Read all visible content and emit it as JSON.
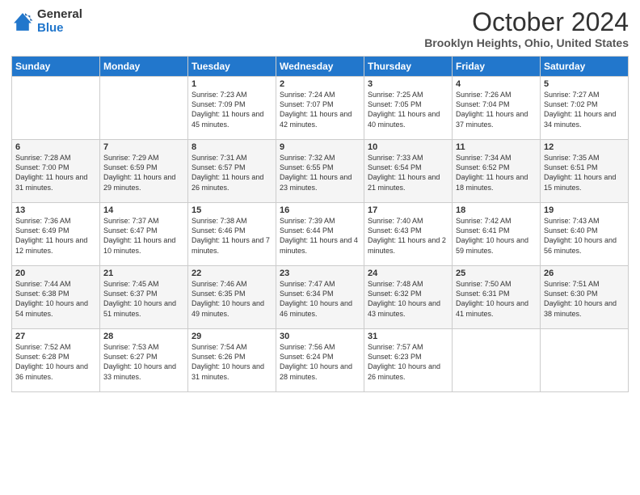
{
  "header": {
    "logo_general": "General",
    "logo_blue": "Blue",
    "title": "October 2024",
    "location": "Brooklyn Heights, Ohio, United States"
  },
  "days_of_week": [
    "Sunday",
    "Monday",
    "Tuesday",
    "Wednesday",
    "Thursday",
    "Friday",
    "Saturday"
  ],
  "weeks": [
    [
      {
        "day": "",
        "info": ""
      },
      {
        "day": "",
        "info": ""
      },
      {
        "day": "1",
        "info": "Sunrise: 7:23 AM\nSunset: 7:09 PM\nDaylight: 11 hours and 45 minutes."
      },
      {
        "day": "2",
        "info": "Sunrise: 7:24 AM\nSunset: 7:07 PM\nDaylight: 11 hours and 42 minutes."
      },
      {
        "day": "3",
        "info": "Sunrise: 7:25 AM\nSunset: 7:05 PM\nDaylight: 11 hours and 40 minutes."
      },
      {
        "day": "4",
        "info": "Sunrise: 7:26 AM\nSunset: 7:04 PM\nDaylight: 11 hours and 37 minutes."
      },
      {
        "day": "5",
        "info": "Sunrise: 7:27 AM\nSunset: 7:02 PM\nDaylight: 11 hours and 34 minutes."
      }
    ],
    [
      {
        "day": "6",
        "info": "Sunrise: 7:28 AM\nSunset: 7:00 PM\nDaylight: 11 hours and 31 minutes."
      },
      {
        "day": "7",
        "info": "Sunrise: 7:29 AM\nSunset: 6:59 PM\nDaylight: 11 hours and 29 minutes."
      },
      {
        "day": "8",
        "info": "Sunrise: 7:31 AM\nSunset: 6:57 PM\nDaylight: 11 hours and 26 minutes."
      },
      {
        "day": "9",
        "info": "Sunrise: 7:32 AM\nSunset: 6:55 PM\nDaylight: 11 hours and 23 minutes."
      },
      {
        "day": "10",
        "info": "Sunrise: 7:33 AM\nSunset: 6:54 PM\nDaylight: 11 hours and 21 minutes."
      },
      {
        "day": "11",
        "info": "Sunrise: 7:34 AM\nSunset: 6:52 PM\nDaylight: 11 hours and 18 minutes."
      },
      {
        "day": "12",
        "info": "Sunrise: 7:35 AM\nSunset: 6:51 PM\nDaylight: 11 hours and 15 minutes."
      }
    ],
    [
      {
        "day": "13",
        "info": "Sunrise: 7:36 AM\nSunset: 6:49 PM\nDaylight: 11 hours and 12 minutes."
      },
      {
        "day": "14",
        "info": "Sunrise: 7:37 AM\nSunset: 6:47 PM\nDaylight: 11 hours and 10 minutes."
      },
      {
        "day": "15",
        "info": "Sunrise: 7:38 AM\nSunset: 6:46 PM\nDaylight: 11 hours and 7 minutes."
      },
      {
        "day": "16",
        "info": "Sunrise: 7:39 AM\nSunset: 6:44 PM\nDaylight: 11 hours and 4 minutes."
      },
      {
        "day": "17",
        "info": "Sunrise: 7:40 AM\nSunset: 6:43 PM\nDaylight: 11 hours and 2 minutes."
      },
      {
        "day": "18",
        "info": "Sunrise: 7:42 AM\nSunset: 6:41 PM\nDaylight: 10 hours and 59 minutes."
      },
      {
        "day": "19",
        "info": "Sunrise: 7:43 AM\nSunset: 6:40 PM\nDaylight: 10 hours and 56 minutes."
      }
    ],
    [
      {
        "day": "20",
        "info": "Sunrise: 7:44 AM\nSunset: 6:38 PM\nDaylight: 10 hours and 54 minutes."
      },
      {
        "day": "21",
        "info": "Sunrise: 7:45 AM\nSunset: 6:37 PM\nDaylight: 10 hours and 51 minutes."
      },
      {
        "day": "22",
        "info": "Sunrise: 7:46 AM\nSunset: 6:35 PM\nDaylight: 10 hours and 49 minutes."
      },
      {
        "day": "23",
        "info": "Sunrise: 7:47 AM\nSunset: 6:34 PM\nDaylight: 10 hours and 46 minutes."
      },
      {
        "day": "24",
        "info": "Sunrise: 7:48 AM\nSunset: 6:32 PM\nDaylight: 10 hours and 43 minutes."
      },
      {
        "day": "25",
        "info": "Sunrise: 7:50 AM\nSunset: 6:31 PM\nDaylight: 10 hours and 41 minutes."
      },
      {
        "day": "26",
        "info": "Sunrise: 7:51 AM\nSunset: 6:30 PM\nDaylight: 10 hours and 38 minutes."
      }
    ],
    [
      {
        "day": "27",
        "info": "Sunrise: 7:52 AM\nSunset: 6:28 PM\nDaylight: 10 hours and 36 minutes."
      },
      {
        "day": "28",
        "info": "Sunrise: 7:53 AM\nSunset: 6:27 PM\nDaylight: 10 hours and 33 minutes."
      },
      {
        "day": "29",
        "info": "Sunrise: 7:54 AM\nSunset: 6:26 PM\nDaylight: 10 hours and 31 minutes."
      },
      {
        "day": "30",
        "info": "Sunrise: 7:56 AM\nSunset: 6:24 PM\nDaylight: 10 hours and 28 minutes."
      },
      {
        "day": "31",
        "info": "Sunrise: 7:57 AM\nSunset: 6:23 PM\nDaylight: 10 hours and 26 minutes."
      },
      {
        "day": "",
        "info": ""
      },
      {
        "day": "",
        "info": ""
      }
    ]
  ]
}
